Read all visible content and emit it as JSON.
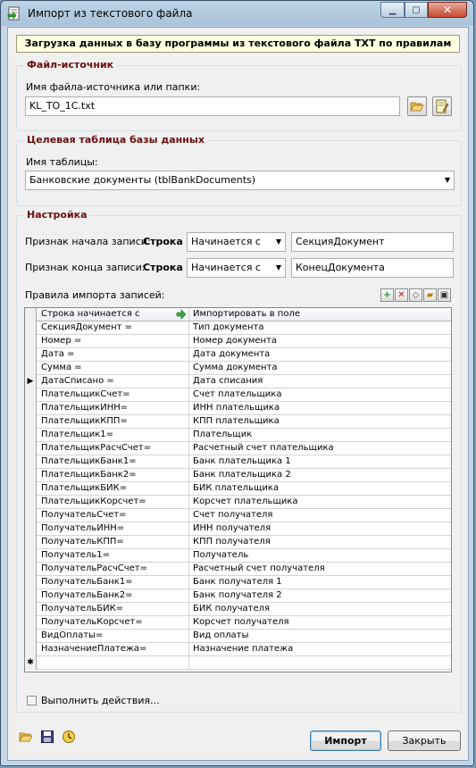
{
  "window": {
    "title": "Импорт из текстового файла"
  },
  "banner": "Загрузка данных в базу программы из текстового файла TXT по правилам",
  "source": {
    "group_title": "Файл-источник",
    "label": "Имя файла-источника или папки:",
    "value": "KL_TO_1C.txt",
    "browse_icon": "folder-open-icon",
    "edit_icon": "edit-file-icon"
  },
  "target": {
    "group_title": "Целевая таблица базы данных",
    "label": "Имя таблицы:",
    "value": "Банковские документы (tblBankDocuments)"
  },
  "settings": {
    "group_title": "Настройка",
    "start": {
      "label": "Признак начала записи:",
      "kind": "Строка",
      "condition": "Начинается с",
      "value": "СекцияДокумент"
    },
    "end": {
      "label": "Признак конца записи:",
      "kind": "Строка",
      "condition": "Начинается с",
      "value": "КонецДокумента"
    },
    "rules_label": "Правила импорта записей:",
    "grid": {
      "col1": "Строка начинается с",
      "col2": "Импортировать в поле",
      "rows": [
        [
          "СекцияДокумент =",
          "Тип документа"
        ],
        [
          "Номер =",
          "Номер документа"
        ],
        [
          "Дата =",
          "Дата документа"
        ],
        [
          "Сумма =",
          "Сумма документа"
        ],
        [
          "ДатаСписано =",
          "Дата списания"
        ],
        [
          "ПлательщикСчет=",
          "Счет плательщика"
        ],
        [
          "ПлательщикИНН=",
          "ИНН плательщика"
        ],
        [
          "ПлательщикКПП=",
          "КПП плательщика"
        ],
        [
          "Плательщик1=",
          "Плательщик"
        ],
        [
          "ПлательщикРасчСчет=",
          "Расчетный счет плательщика"
        ],
        [
          "ПлательщикБанк1=",
          "Банк плательщика 1"
        ],
        [
          "ПлательщикБанк2=",
          "Банк плательщика 2"
        ],
        [
          "ПлательщикБИК=",
          "БИК плательщика"
        ],
        [
          "ПлательщикКорсчет=",
          "Корсчет плательщика"
        ],
        [
          "ПолучательСчет=",
          "Счет получателя"
        ],
        [
          "ПолучательИНН=",
          "ИНН получателя"
        ],
        [
          "ПолучательКПП=",
          "КПП получателя"
        ],
        [
          "Получатель1=",
          "Получатель"
        ],
        [
          "ПолучательРасчСчет=",
          "Расчетный счет получателя"
        ],
        [
          "ПолучательБанк1=",
          "Банк получателя 1"
        ],
        [
          "ПолучательБанк2=",
          "Банк получателя 2"
        ],
        [
          "ПолучательБИК=",
          "БИК получателя"
        ],
        [
          "ПолучательКорсчет=",
          "Корсчет получателя"
        ],
        [
          "ВидОплаты=",
          "Вид оплаты"
        ],
        [
          "НазначениеПлатежа=",
          "Назначение платежа"
        ]
      ],
      "current_row_marker": "▶",
      "new_row_marker": "✱"
    }
  },
  "execute_actions": {
    "label": "Выполнить действия...",
    "checked": false
  },
  "buttons": {
    "import": "Импорт",
    "close": "Закрыть"
  },
  "colors": {
    "group_title": "#6b0f0f",
    "banner_bg": "#ffffe1"
  }
}
